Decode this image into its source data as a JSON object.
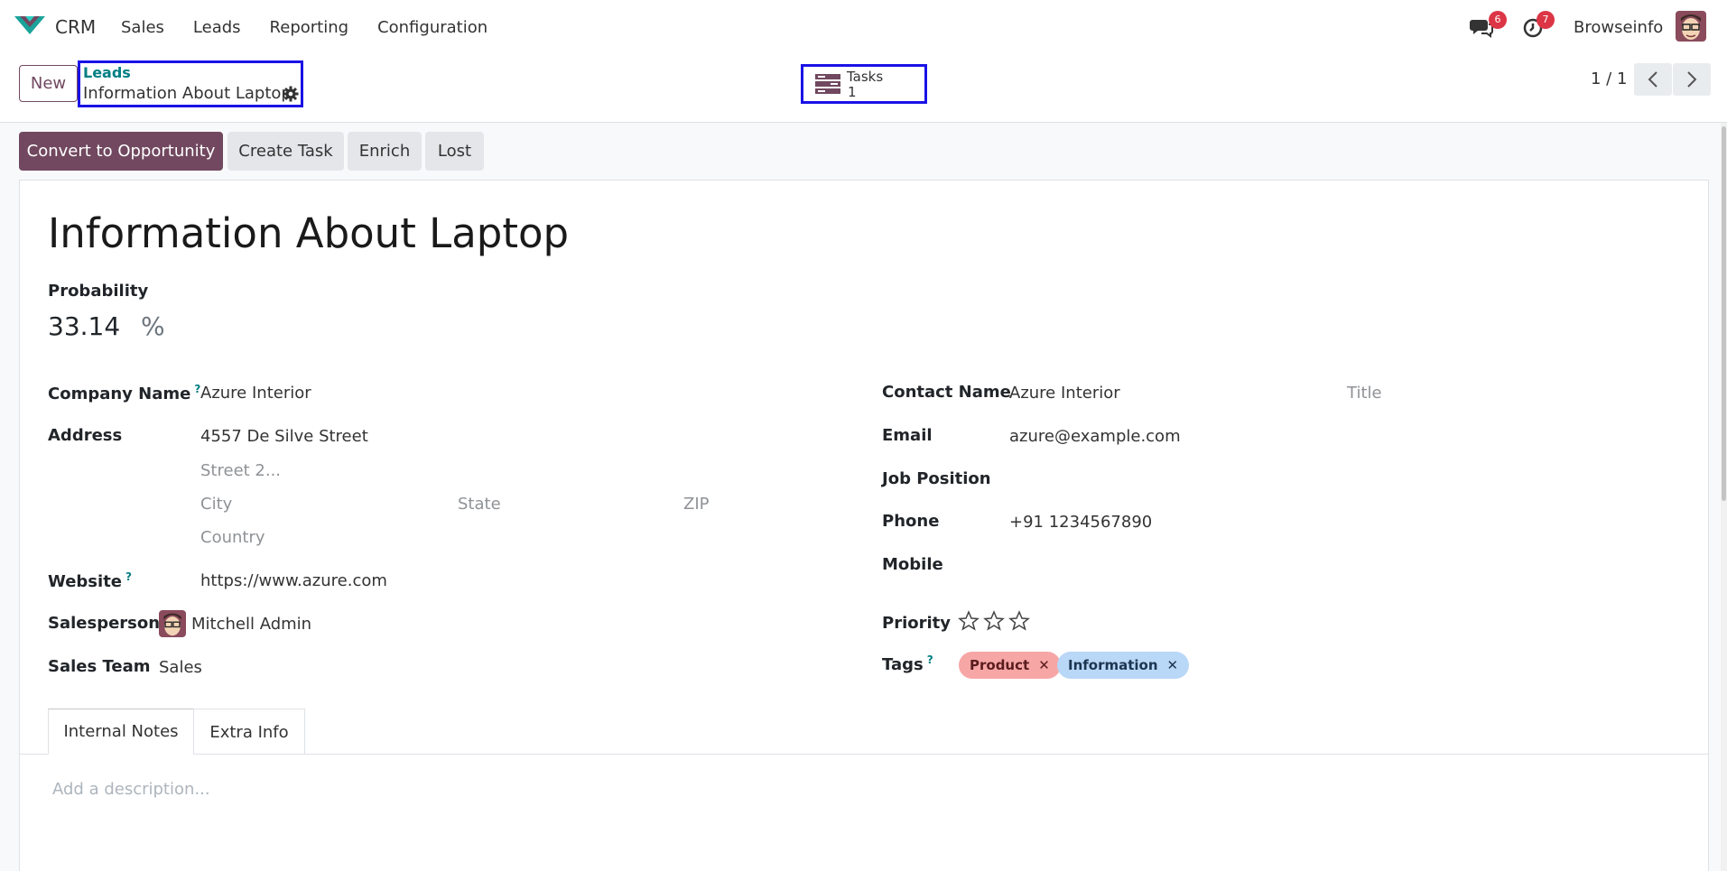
{
  "nav": {
    "app_name": "CRM",
    "menu": [
      "Sales",
      "Leads",
      "Reporting",
      "Configuration"
    ],
    "messages_badge": "6",
    "activities_badge": "7",
    "user_name": "Browseinfo",
    "accent_color": "#71485f"
  },
  "control": {
    "new_label": "New",
    "breadcrumb_parent": "Leads",
    "breadcrumb_current": "Information About Laptop",
    "tasks_label": "Tasks",
    "tasks_count": "1",
    "pager": "1 / 1"
  },
  "actions": {
    "convert": "Convert to Opportunity",
    "create_task": "Create Task",
    "enrich": "Enrich",
    "lost": "Lost"
  },
  "form": {
    "title": "Information About Laptop",
    "probability_label": "Probability",
    "probability_value": "33.14",
    "probability_unit": "%",
    "company_name_label": "Company Name",
    "company_name_help": "?",
    "company_name": "Azure Interior",
    "address_label": "Address",
    "street": "4557 De Silve Street",
    "street2_placeholder": "Street 2...",
    "city_placeholder": "City",
    "state_placeholder": "State",
    "zip_placeholder": "ZIP",
    "country_placeholder": "Country",
    "website_label": "Website",
    "website_help": "?",
    "website": "https://www.azure.com",
    "salesperson_label": "Salesperson",
    "salesperson": "Mitchell Admin",
    "sales_team_label": "Sales Team",
    "sales_team": "Sales",
    "contact_name_label": "Contact Name",
    "contact_name": "Azure Interior",
    "title_placeholder": "Title",
    "email_label": "Email",
    "email": "azure@example.com",
    "job_position_label": "Job Position",
    "phone_label": "Phone",
    "phone": "+91 1234567890",
    "mobile_label": "Mobile",
    "priority_label": "Priority",
    "priority_stars": 0,
    "tags_label": "Tags",
    "tags_help": "?",
    "tags": [
      {
        "label": "Product",
        "color": "#f7a6a6"
      },
      {
        "label": "Information",
        "color": "#b9d7f7"
      }
    ]
  },
  "tabs": {
    "internal_notes": "Internal Notes",
    "extra_info": "Extra Info",
    "description_placeholder": "Add a description..."
  }
}
